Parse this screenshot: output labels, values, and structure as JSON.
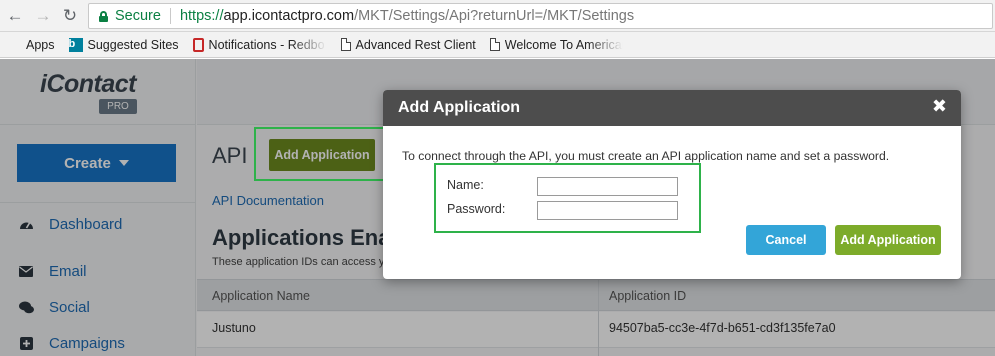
{
  "browser": {
    "secure_label": "Secure",
    "url_scheme": "https://",
    "url_host": "app.icontactpro.com",
    "url_path": "/MKT/Settings/Api?returnUrl=/MKT/Settings",
    "bookmarks": [
      {
        "label": "Apps",
        "icon": "apps-grid-icon"
      },
      {
        "label": "Suggested Sites",
        "icon": "bing-icon"
      },
      {
        "label": "Notifications - Redbo",
        "icon": "redbooth-icon"
      },
      {
        "label": "Advanced Rest Client",
        "icon": "page-icon"
      },
      {
        "label": "Welcome To American",
        "icon": "page-icon"
      }
    ]
  },
  "sidebar": {
    "logo_text": "iContact",
    "logo_badge": "PRO",
    "create_label": "Create",
    "items": [
      {
        "label": "Dashboard",
        "icon": "gauge-icon"
      },
      {
        "label": "Email",
        "icon": "envelope-icon"
      },
      {
        "label": "Social",
        "icon": "chat-bubbles-icon"
      },
      {
        "label": "Campaigns",
        "icon": "plus-square-icon"
      }
    ]
  },
  "main": {
    "title": "API",
    "add_button_label": "Add Application",
    "doc_link": "API Documentation",
    "heading": "Applications Enabled",
    "subtext": "These application IDs can access your account",
    "table": {
      "columns": [
        "Application Name",
        "Application ID"
      ],
      "rows": [
        [
          "Justuno",
          "94507ba5-cc3e-4f7d-b651-cd3f135fe7a0"
        ]
      ]
    }
  },
  "modal": {
    "title": "Add Application",
    "close_glyph": "✖",
    "description": "To connect through the API, you must create an API application name and set a password.",
    "fields": [
      {
        "label": "Name:",
        "value": ""
      },
      {
        "label": "Password:",
        "value": ""
      }
    ],
    "cancel_label": "Cancel",
    "submit_label": "Add Application"
  },
  "colors": {
    "highlight": "#2eb24a",
    "create_button": "#1775c7",
    "cancel_button": "#33a5d8",
    "submit_button": "#7dab2a",
    "modal_header": "#4d4d4d"
  }
}
